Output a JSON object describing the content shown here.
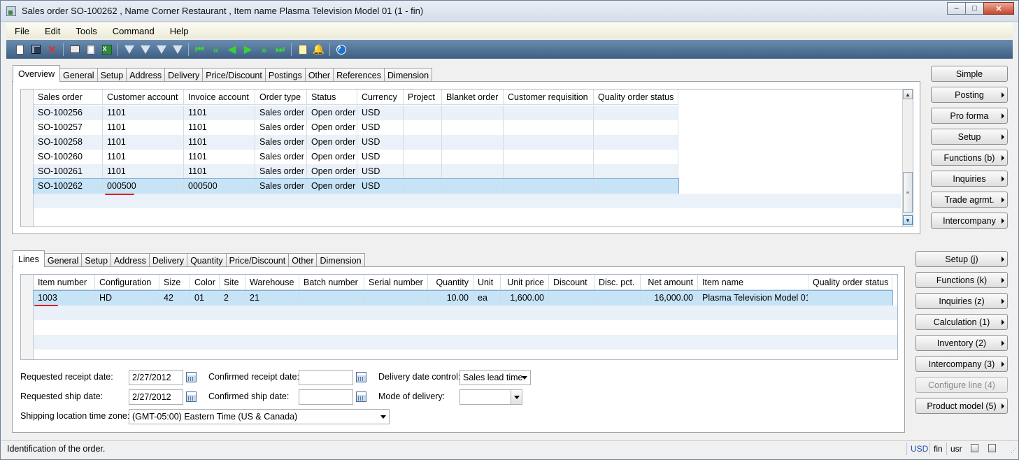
{
  "window": {
    "title": "Sales order SO-100262 , Name Corner Restaurant , Item name Plasma Television Model 01 (1 - fin)",
    "controls": [
      "–",
      "□",
      "✕"
    ]
  },
  "menu": [
    "File",
    "Edit",
    "Tools",
    "Command",
    "Help"
  ],
  "toolbar_icons": [
    "new-icon",
    "save-icon",
    "delete-icon",
    "print-icon",
    "print-preview-icon",
    "export-excel-icon",
    "filter-icon",
    "filter-by-selection-icon",
    "advanced-filter-icon",
    "remove-filter-icon",
    "first-record-icon",
    "previous-page-icon",
    "previous-record-icon",
    "next-record-icon",
    "next-page-icon",
    "last-record-icon",
    "document-handling-icon",
    "alert-icon",
    "help-icon"
  ],
  "header_tabs": [
    "Overview",
    "General",
    "Setup",
    "Address",
    "Delivery",
    "Price/Discount",
    "Postings",
    "Other",
    "References",
    "Dimension"
  ],
  "orders": {
    "columns": [
      "Sales order",
      "Customer account",
      "Invoice account",
      "Order type",
      "Status",
      "Currency",
      "Project",
      "Blanket order",
      "Customer requisition",
      "Quality order status"
    ],
    "sort_indicator": "▲",
    "rows": [
      [
        "SO-100256",
        "1101",
        "1101",
        "Sales order",
        "Open order",
        "USD",
        "",
        "",
        "",
        ""
      ],
      [
        "SO-100257",
        "1101",
        "1101",
        "Sales order",
        "Open order",
        "USD",
        "",
        "",
        "",
        ""
      ],
      [
        "SO-100258",
        "1101",
        "1101",
        "Sales order",
        "Open order",
        "USD",
        "",
        "",
        "",
        ""
      ],
      [
        "SO-100260",
        "1101",
        "1101",
        "Sales order",
        "Open order",
        "USD",
        "",
        "",
        "",
        ""
      ],
      [
        "SO-100261",
        "1101",
        "1101",
        "Sales order",
        "Open order",
        "USD",
        "",
        "",
        "",
        ""
      ],
      [
        "SO-100262",
        "000500",
        "000500",
        "Sales order",
        "Open order",
        "USD",
        "",
        "",
        "",
        ""
      ]
    ],
    "selected_row": 5
  },
  "header_buttons": [
    "Simple",
    "Posting",
    "Pro forma",
    "Setup",
    "Functions (b)",
    "Inquiries",
    "Trade agrmt.",
    "Intercompany"
  ],
  "line_tabs": [
    "Lines",
    "General",
    "Setup",
    "Address",
    "Delivery",
    "Quantity",
    "Price/Discount",
    "Other",
    "Dimension"
  ],
  "lines": {
    "columns": [
      "Item number",
      "Configuration",
      "Size",
      "Color",
      "Site",
      "Warehouse",
      "Batch number",
      "Serial number",
      "Quantity",
      "Unit",
      "Unit price",
      "Discount",
      "Disc. pct.",
      "Net amount",
      "Item name",
      "Quality order status"
    ],
    "rows": [
      [
        "1003",
        "HD",
        "42",
        "01",
        "2",
        "21",
        "",
        "",
        "10.00",
        "ea",
        "1,600.00",
        "",
        "",
        "16,000.00",
        "Plasma Television Model 01",
        ""
      ]
    ]
  },
  "line_buttons": [
    {
      "label": "Setup (j)",
      "enabled": true
    },
    {
      "label": "Functions (k)",
      "enabled": true
    },
    {
      "label": "Inquiries (z)",
      "enabled": true
    },
    {
      "label": "Calculation (1)",
      "enabled": true
    },
    {
      "label": "Inventory (2)",
      "enabled": true
    },
    {
      "label": "Intercompany (3)",
      "enabled": true
    },
    {
      "label": "Configure line (4)",
      "enabled": false
    },
    {
      "label": "Product model (5)",
      "enabled": true
    }
  ],
  "form": {
    "requested_receipt_date_label": "Requested receipt date:",
    "requested_receipt_date": "2/27/2012",
    "requested_ship_date_label": "Requested ship date:",
    "requested_ship_date": "2/27/2012",
    "confirmed_receipt_date_label": "Confirmed receipt date:",
    "confirmed_receipt_date": "",
    "confirmed_ship_date_label": "Confirmed ship date:",
    "confirmed_ship_date": "",
    "delivery_date_control_label": "Delivery date control:",
    "delivery_date_control": "Sales lead time",
    "mode_of_delivery_label": "Mode of delivery:",
    "mode_of_delivery": "",
    "shipping_time_zone_label": "Shipping location time zone:",
    "shipping_time_zone": "(GMT-05:00) Eastern Time (US & Canada)"
  },
  "status": {
    "text": "Identification of the order.",
    "currency": "USD",
    "company": "fin",
    "layer": "usr"
  }
}
